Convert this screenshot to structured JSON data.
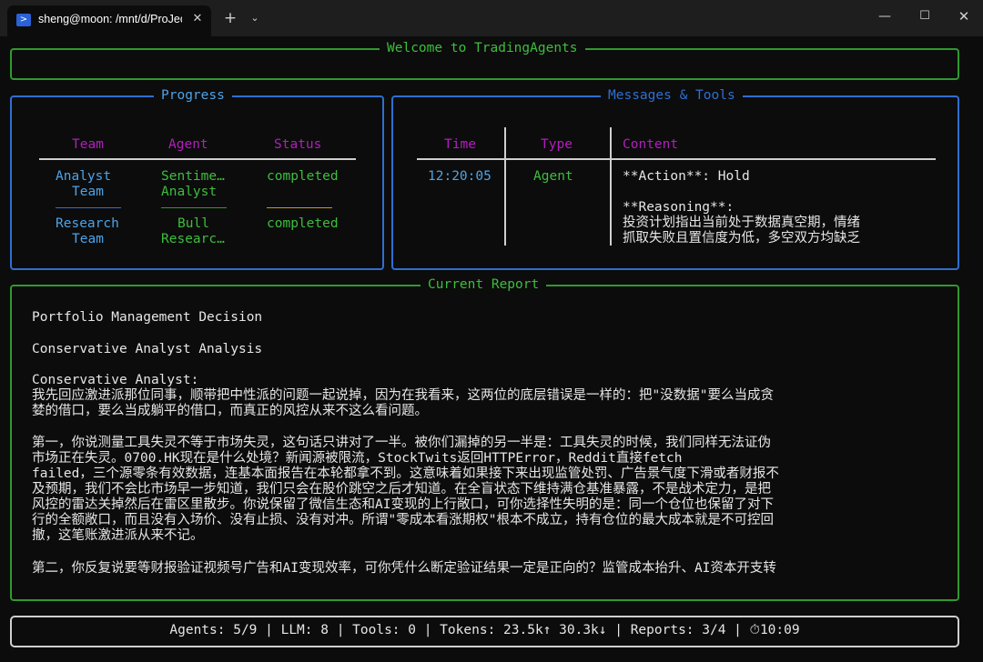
{
  "window": {
    "tab_icon": "powershell-icon",
    "tab_title": "sheng@moon: /mnt/d/ProJects/TradingAgents",
    "tab_close": "✕",
    "new_tab": "+",
    "dropdown": "⌄",
    "minimize": "—",
    "maximize": "☐",
    "close": "✕"
  },
  "welcome": {
    "title": "Welcome to TradingAgents"
  },
  "progress": {
    "title": "Progress",
    "headers": {
      "team": "Team",
      "agent": "Agent",
      "status": "Status"
    },
    "rows": [
      {
        "team": [
          "Analyst",
          "Team"
        ],
        "agent": [
          "Sentime…",
          "Analyst"
        ],
        "status": "completed"
      },
      {
        "team": [
          "Research",
          "Team"
        ],
        "agent": [
          "Bull",
          "Researc…"
        ],
        "status": "completed"
      }
    ]
  },
  "messages": {
    "title": "Messages & Tools",
    "headers": {
      "time": "Time",
      "type": "Type",
      "content": "Content"
    },
    "rows": [
      {
        "time": "12:20:05",
        "type": "Agent",
        "content": [
          "**Action**: Hold",
          "",
          "**Reasoning**:",
          "投资计划指出当前处于数据真空期，情绪",
          "抓取失败且置信度为低，多空双方均缺乏"
        ]
      }
    ]
  },
  "report": {
    "title": "Current Report",
    "heading1": "Portfolio Management Decision",
    "heading2": "Conservative Analyst Analysis",
    "lines": [
      "Conservative Analyst:",
      "我先回应激进派那位同事，顺带把中性派的问题一起说掉，因为在我看来，这两位的底层错误是一样的：把\"没数据\"要么当成贪",
      "婪的借口，要么当成躺平的借口，而真正的风控从来不这么看问题。",
      "",
      "第一，你说测量工具失灵不等于市场失灵，这句话只讲对了一半。被你们漏掉的另一半是：工具失灵的时候，我们同样无法证伪",
      "市场正在失灵。0700.HK现在是什么处境？新闻源被限流，StockTwits返回HTTPError，Reddit直接fetch",
      "failed，三个源零条有效数据，连基本面报告在本轮都拿不到。这意味着如果接下来出现监管处罚、广告景气度下滑或者财报不",
      "及预期，我们不会比市场早一步知道，我们只会在股价跳空之后才知道。在全盲状态下维持满仓基准暴露，不是战术定力，是把",
      "风控的雷达关掉然后在雷区里散步。你说保留了微信生态和AI变现的上行敞口，可你选择性失明的是：同一个仓位也保留了对下",
      "行的全额敞口，而且没有入场价、没有止损、没有对冲。所谓\"零成本看涨期权\"根本不成立，持有仓位的最大成本就是不可控回",
      "撤，这笔账激进派从来不记。",
      "",
      "第二，你反复说要等财报验证视频号广告和AI变现效率，可你凭什么断定验证结果一定是正向的？监管成本抬升、AI资本开支转"
    ]
  },
  "status": {
    "text": "Agents: 5/9 | LLM: 8 | Tools: 0 | Tokens: 23.5k↑ 30.3k↓ | Reports: 3/4 | ⏱10:09"
  },
  "colors": {
    "background": "#0c0c0c",
    "green": "#3dbe3d",
    "blue": "#4da3e8",
    "magenta": "#b21ebe",
    "yellow": "#c4a000"
  }
}
